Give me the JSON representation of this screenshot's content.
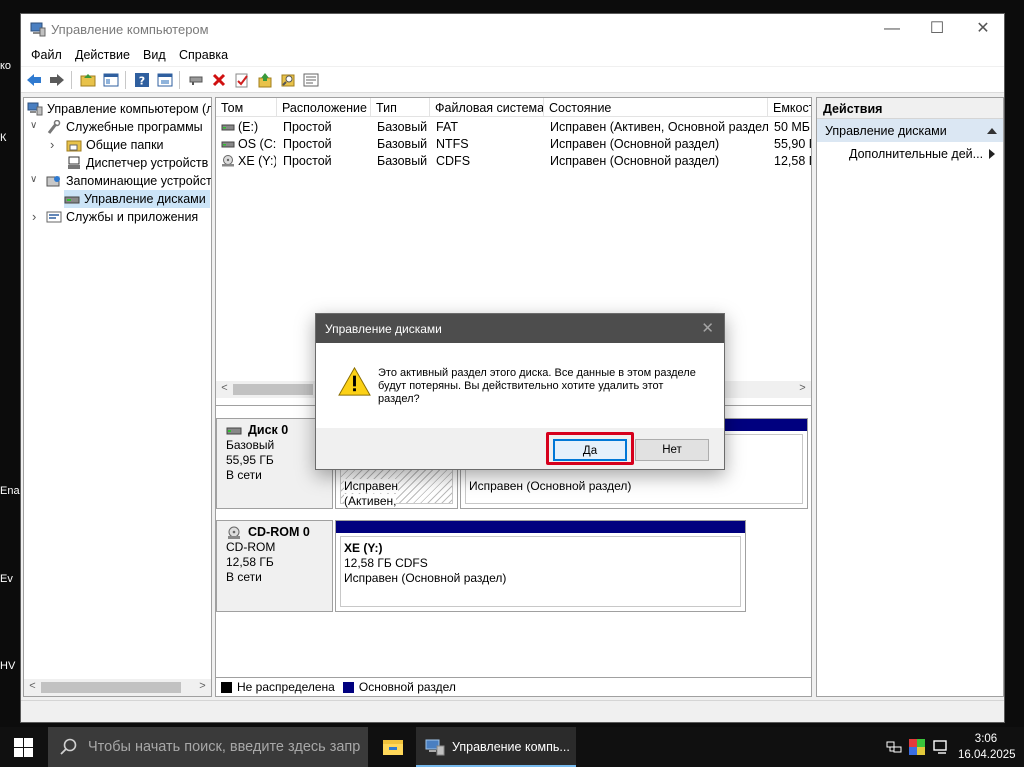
{
  "desktop": {
    "fragments": [
      "ко",
      "К",
      "Ena",
      "Ev",
      "HV"
    ]
  },
  "window": {
    "title": "Управление компьютером",
    "minimize": "—",
    "maximize": "☐",
    "close": "✕"
  },
  "menu": {
    "items": [
      "Файл",
      "Действие",
      "Вид",
      "Справка"
    ]
  },
  "toolbar": {
    "icons": [
      "back-arrow-icon",
      "forward-arrow-icon",
      "up-folder-icon",
      "show-hide-tree-icon",
      "help-icon",
      "properties-icon",
      "connect-icon",
      "delete-icon",
      "check-icon",
      "export-icon",
      "search-icon",
      "list-icon"
    ]
  },
  "tree": {
    "items": [
      {
        "label": "Управление компьютером (л",
        "level": 0,
        "expander": "",
        "icon": "computer-management-icon"
      },
      {
        "label": "Служебные программы",
        "level": 1,
        "expander": "∨",
        "icon": "tools-icon"
      },
      {
        "label": "Общие папки",
        "level": 2,
        "expander": "›",
        "icon": "shared-folder-icon"
      },
      {
        "label": "Диспетчер устройств",
        "level": 2,
        "expander": "",
        "icon": "device-manager-icon"
      },
      {
        "label": "Запоминающие устройст",
        "level": 1,
        "expander": "∨",
        "icon": "storage-icon"
      },
      {
        "label": "Управление дисками",
        "level": 2,
        "expander": "",
        "icon": "disk-management-icon",
        "selected": true
      },
      {
        "label": "Службы и приложения",
        "level": 1,
        "expander": "›",
        "icon": "services-icon"
      }
    ]
  },
  "volumes": {
    "columns": [
      "Том",
      "Расположение",
      "Тип",
      "Файловая система",
      "Состояние",
      "Емкост"
    ],
    "rows": [
      [
        "(E:)",
        "Простой",
        "Базовый",
        "FAT",
        "Исправен (Активен, Основной раздел)",
        "50 МБ"
      ],
      [
        "OS (C:)",
        "Простой",
        "Базовый",
        "NTFS",
        "Исправен (Основной раздел)",
        "55,90 Г"
      ],
      [
        "XE (Y:)",
        "Простой",
        "Базовый",
        "CDFS",
        "Исправен (Основной раздел)",
        "12,58 Г"
      ]
    ]
  },
  "disks": [
    {
      "name": "Диск 0",
      "type": "Базовый",
      "size": "55,95 ГБ",
      "status": "В сети"
    },
    {
      "name": "CD-ROM 0",
      "type": "CD-ROM",
      "size": "12,58 ГБ",
      "status": "В сети"
    }
  ],
  "partitions": {
    "disk0_p1_status": "Исправен (Активен,",
    "disk0_p2_status": "Исправен (Основной раздел)",
    "cd_label": "XE  (Y:)",
    "cd_size": "12,58 ГБ CDFS",
    "cd_status": "Исправен (Основной раздел)"
  },
  "legend": {
    "unallocated": "Не распределена",
    "primary": "Основной раздел",
    "colors": {
      "unallocated": "#000000",
      "primary": "#00007f"
    }
  },
  "actions": {
    "header": "Действия",
    "section": "Управление дисками",
    "more": "Дополнительные дей..."
  },
  "dialog": {
    "title": "Управление дисками",
    "message": "Это активный раздел этого диска. Все данные в этом разделе будут потеряны. Вы действительно хотите удалить этот раздел?",
    "yes": "Да",
    "no": "Нет"
  },
  "taskbar": {
    "search_placeholder": "Чтобы начать поиск, введите здесь запр",
    "app_label": "Управление компь...",
    "time": "3:06",
    "date": "16.04.2025"
  }
}
